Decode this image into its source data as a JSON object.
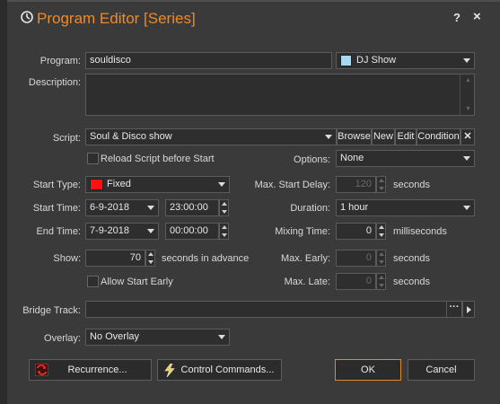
{
  "title": "Program Editor [Series]",
  "titlebar": {
    "help": "?",
    "close": "×"
  },
  "program": {
    "label": "Program:",
    "value": "souldisco",
    "type_value": "DJ Show",
    "type_color": "#a8d8f0"
  },
  "description": {
    "label": "Description:",
    "value": ""
  },
  "script": {
    "label": "Script:",
    "value": "Soul & Disco show",
    "browse": "Browse",
    "new": "New",
    "edit": "Edit",
    "condition": "Condition",
    "clear": "✕"
  },
  "reload": {
    "label": "Reload Script before Start"
  },
  "options": {
    "label": "Options:",
    "value": "None"
  },
  "start_type": {
    "label": "Start Type:",
    "value": "Fixed",
    "color": "#ff1010"
  },
  "max_start_delay": {
    "label": "Max. Start Delay:",
    "value": "120",
    "unit": "seconds"
  },
  "start_time": {
    "label": "Start Time:",
    "date": "6-9-2018",
    "time": "23:00:00"
  },
  "duration": {
    "label": "Duration:",
    "value": "1 hour"
  },
  "end_time": {
    "label": "End Time:",
    "date": "7-9-2018",
    "time": "00:00:00"
  },
  "mixing_time": {
    "label": "Mixing Time:",
    "value": "0",
    "unit": "milliseconds"
  },
  "show": {
    "label": "Show:",
    "value": "70",
    "unit": "seconds in advance"
  },
  "max_early": {
    "label": "Max. Early:",
    "value": "0",
    "unit": "seconds"
  },
  "allow_start_early": {
    "label": "Allow Start Early"
  },
  "max_late": {
    "label": "Max. Late:",
    "value": "0",
    "unit": "seconds"
  },
  "bridge_track": {
    "label": "Bridge Track:",
    "value": "",
    "dots": "···"
  },
  "overlay": {
    "label": "Overlay:",
    "value": "No Overlay"
  },
  "buttons": {
    "recurrence": "Recurrence...",
    "control_commands": "Control Commands...",
    "ok": "OK",
    "cancel": "Cancel"
  }
}
